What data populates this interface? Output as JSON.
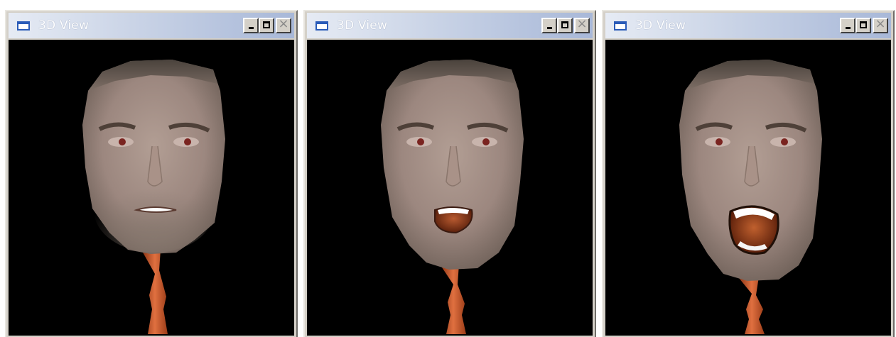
{
  "windows": [
    {
      "title": "3D View",
      "icon": "window-icon",
      "controls": [
        "minimize-icon",
        "maximize-icon",
        "close-icon"
      ],
      "mouth_state": "closed",
      "mouth_openness": 0.0
    },
    {
      "title": "3D View",
      "icon": "window-icon",
      "controls": [
        "minimize-icon",
        "maximize-icon",
        "close-icon"
      ],
      "mouth_state": "half-open",
      "mouth_openness": 0.5
    },
    {
      "title": "3D View",
      "icon": "window-icon",
      "controls": [
        "minimize-icon",
        "maximize-icon",
        "close-icon"
      ],
      "mouth_state": "wide-open",
      "mouth_openness": 1.0
    }
  ],
  "colors": {
    "background": "#000000",
    "titlebar_start": "#e6ebf4",
    "titlebar_end": "#a8b8d8",
    "skin": "#a08c84",
    "neck": "#cc5a2c",
    "mouth_interior": "#7a2e14",
    "teeth": "#ffffff"
  }
}
